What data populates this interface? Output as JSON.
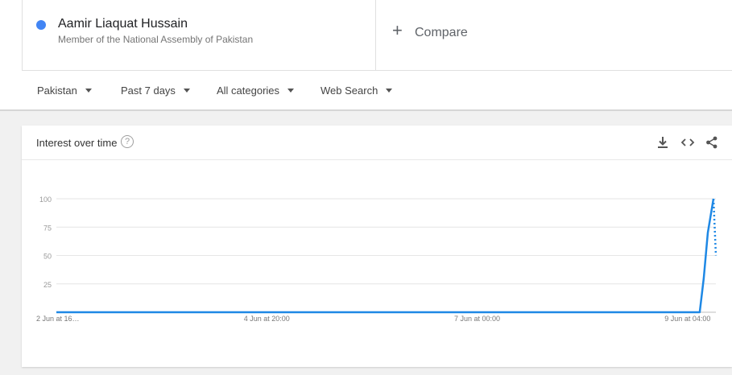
{
  "term": {
    "name": "Aamir Liaquat Hussain",
    "description": "Member of the National Assembly of Pakistan",
    "color": "#4285f4"
  },
  "compare": {
    "plus": "+",
    "label": "Compare"
  },
  "filters": [
    {
      "label": "Pakistan"
    },
    {
      "label": "Past 7 days"
    },
    {
      "label": "All categories"
    },
    {
      "label": "Web Search"
    }
  ],
  "card": {
    "title": "Interest over time",
    "help_glyph": "?",
    "icons": [
      "download-icon",
      "embed-icon",
      "share-icon"
    ]
  },
  "chart_data": {
    "type": "line",
    "title": "",
    "xlabel": "",
    "ylabel": "",
    "ylim": [
      0,
      100
    ],
    "yticks": [
      25,
      50,
      75,
      100
    ],
    "xtick_labels": [
      "2 Jun at 16…",
      "4 Jun at 20:00",
      "7 Jun at 00:00",
      "9 Jun at 04:00"
    ],
    "xtick_positions_hours": [
      0,
      52,
      104,
      156
    ],
    "series": [
      {
        "color": "#1e88e5",
        "x_hours": [
          0,
          40,
          80,
          120,
          159,
          160,
          161,
          162.4
        ],
        "values": [
          0,
          0,
          0,
          0,
          0,
          30,
          70,
          100
        ]
      }
    ],
    "partial_series": {
      "x_hours": [
        162.4,
        163
      ],
      "values": [
        100,
        50
      ],
      "dashed": true
    },
    "x_range_hours": [
      0,
      163
    ],
    "grid": true
  }
}
